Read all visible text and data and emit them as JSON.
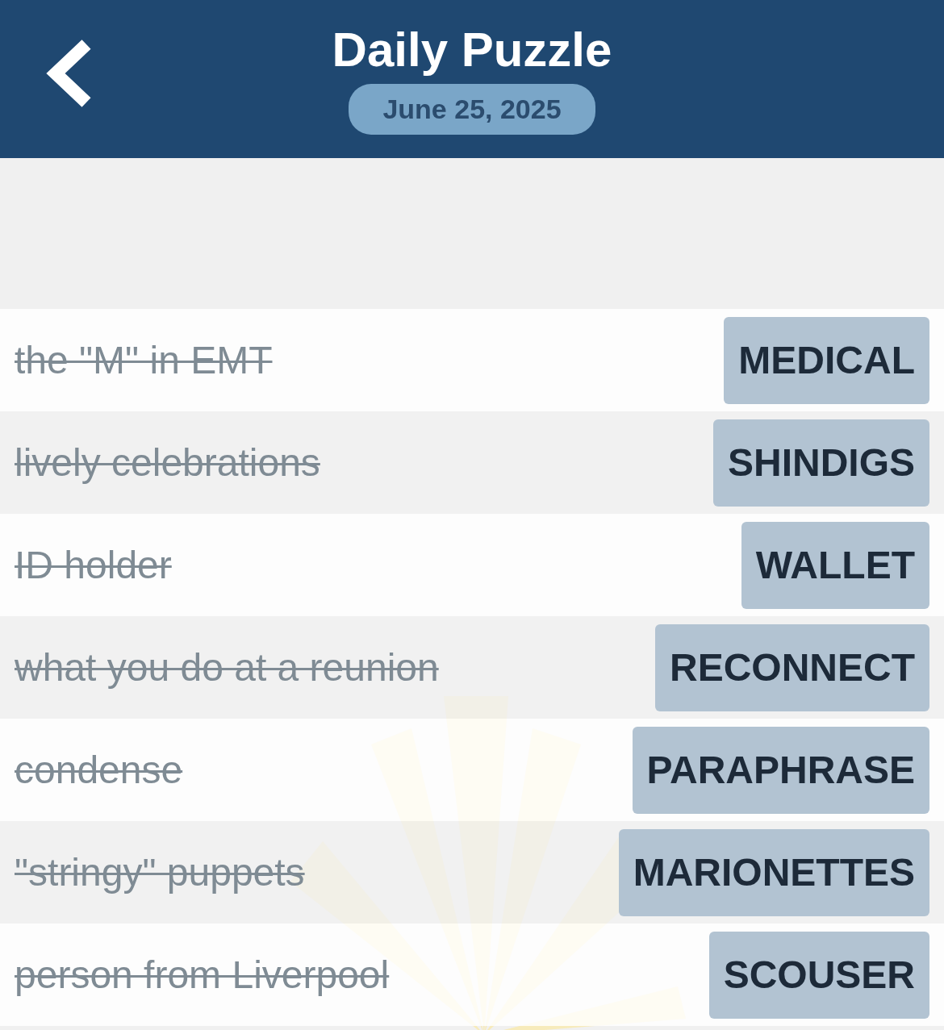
{
  "header": {
    "title": "Daily Puzzle",
    "date": "June 25, 2025"
  },
  "clues": [
    {
      "clue": "the \"M\" in EMT",
      "answer": "MEDICAL",
      "solved": true
    },
    {
      "clue": "lively celebrations",
      "answer": "SHINDIGS",
      "solved": true
    },
    {
      "clue": "ID holder",
      "answer": "WALLET",
      "solved": true
    },
    {
      "clue": "what you do at a reunion",
      "answer": "RECONNECT",
      "solved": true
    },
    {
      "clue": "condense",
      "answer": "PARAPHRASE",
      "solved": true
    },
    {
      "clue": "\"stringy\" puppets",
      "answer": "MARIONETTES",
      "solved": true
    },
    {
      "clue": "person from Liverpool",
      "answer": "SCOUSER",
      "solved": true
    }
  ]
}
